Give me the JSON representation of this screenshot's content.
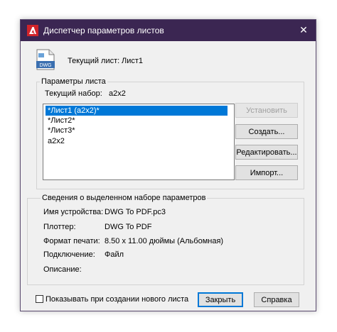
{
  "window": {
    "title": "Диспетчер параметров листов",
    "close_glyph": "✕"
  },
  "current_sheet": {
    "icon_label": "DWG",
    "label": "Текущий лист:",
    "value": "Лист1"
  },
  "sheet_params": {
    "legend": "Параметры листа",
    "current_set_label": "Текущий набор:",
    "current_set_value": "a2x2",
    "items": [
      {
        "label": "*Лист1 (a2x2)*",
        "selected": true
      },
      {
        "label": "*Лист2*",
        "selected": false
      },
      {
        "label": "*Лист3*",
        "selected": false
      },
      {
        "label": "a2x2",
        "selected": false
      }
    ],
    "buttons": {
      "set_current": "Установить",
      "create": "Создать...",
      "edit": "Редактировать...",
      "import": "Импорт..."
    }
  },
  "details": {
    "legend": "Сведения о выделенном наборе параметров",
    "rows": [
      {
        "label": "Имя устройства:",
        "value": "DWG To PDF.pc3"
      },
      {
        "label": "Плоттер:",
        "value": "DWG To PDF"
      },
      {
        "label": "Формат печати:",
        "value": "8.50 x 11.00 дюймы (Альбомная)"
      },
      {
        "label": "Подключение:",
        "value": "Файл"
      },
      {
        "label": "Описание:",
        "value": ""
      }
    ]
  },
  "footer": {
    "checkbox_label": "Показывать при создании нового листа",
    "checkbox_checked": false,
    "close_button": "Закрыть",
    "help_button": "Справка"
  },
  "colors": {
    "titlebar": "#3b2652",
    "selection": "#0078d7",
    "app_icon": "#d2242a"
  }
}
